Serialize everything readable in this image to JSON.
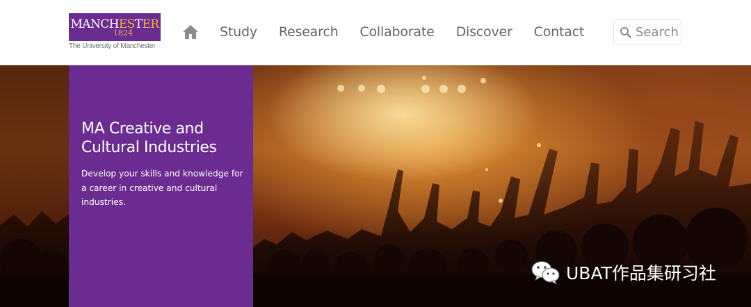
{
  "header": {
    "logo": {
      "name_parts": [
        "MANCH",
        "ES",
        "T",
        "ER"
      ],
      "year": "1824",
      "subtitle": "The University of Manchester"
    },
    "nav": {
      "home_icon": "home-icon",
      "items": [
        "Study",
        "Research",
        "Collaborate",
        "Discover",
        "Contact"
      ]
    },
    "search": {
      "icon": "search-icon",
      "placeholder": "Search"
    }
  },
  "hero": {
    "title": "MA Creative and Cultural Industries",
    "description": "Develop your skills and knowledge for a career in creative and cultural industries."
  },
  "watermark": {
    "icon": "wechat-icon",
    "text": "UBAT作品集研习社"
  },
  "colors": {
    "brand_purple": "#6a2c91",
    "brand_gold": "#f2b632",
    "nav_text": "#666666"
  }
}
